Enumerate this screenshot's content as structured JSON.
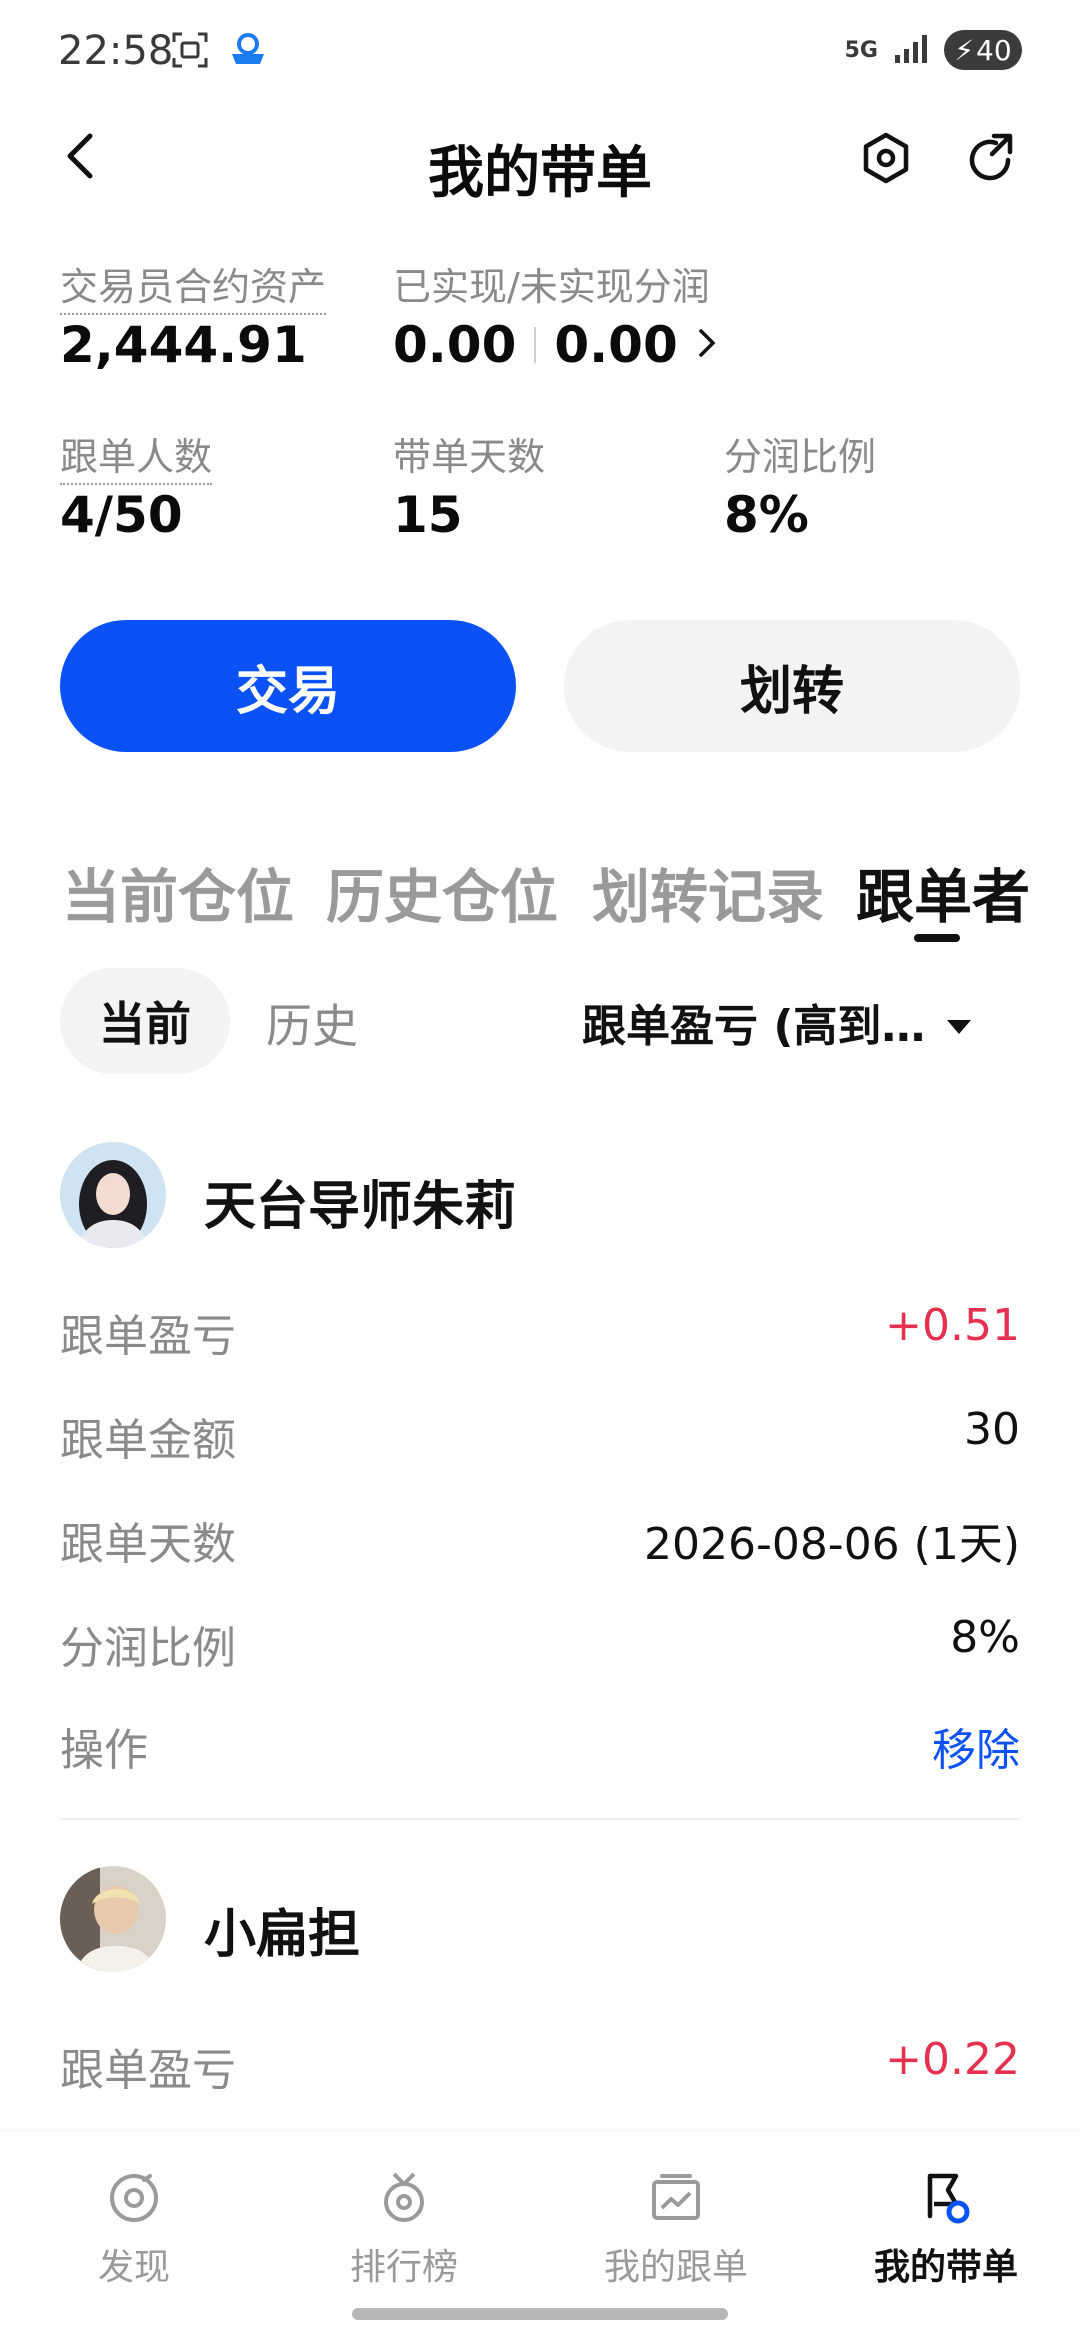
{
  "status_bar": {
    "time": "22:58",
    "network": "5G",
    "battery": "40",
    "icons": [
      "scan-icon",
      "app-badge-icon",
      "signal-icon",
      "charging-icon"
    ]
  },
  "header": {
    "title": "我的带单",
    "icons": [
      "back-icon",
      "settings-icon",
      "share-icon"
    ]
  },
  "stats": {
    "assets_label": "交易员合约资产",
    "assets_value": "2,444.91",
    "profit_label": "已实现/未实现分润",
    "realized": "0.00",
    "unrealized": "0.00",
    "followers_label": "跟单人数",
    "followers_value": "4/50",
    "days_label": "带单天数",
    "days_value": "15",
    "share_label": "分润比例",
    "share_value": "8%"
  },
  "actions": {
    "trade": "交易",
    "transfer": "划转"
  },
  "tabs": [
    "当前仓位",
    "历史仓位",
    "划转记录",
    "跟单者"
  ],
  "active_tab": "跟单者",
  "subtabs": {
    "current": "当前",
    "history": "历史",
    "sort": "跟单盈亏 (高到…"
  },
  "followers": [
    {
      "name": "天台导师朱莉",
      "pnl_label": "跟单盈亏",
      "pnl_value": "+0.51",
      "amount_label": "跟单金额",
      "amount_value": "30",
      "days_label": "跟单天数",
      "days_value": "2026-08-06 (1天)",
      "share_label": "分润比例",
      "share_value": "8%",
      "op_label": "操作",
      "op_value": "移除"
    },
    {
      "name": "小扁担",
      "pnl_label": "跟单盈亏",
      "pnl_value": "+0.22"
    }
  ],
  "bottom_nav": [
    {
      "label": "发现",
      "icon": "discover-icon"
    },
    {
      "label": "排行榜",
      "icon": "ranking-icon"
    },
    {
      "label": "我的跟单",
      "icon": "my-copy-icon"
    },
    {
      "label": "我的带单",
      "icon": "my-lead-icon"
    }
  ],
  "colors": {
    "accent": "#0a52f5",
    "profit": "#e5304f",
    "muted": "#8a8a8a"
  }
}
